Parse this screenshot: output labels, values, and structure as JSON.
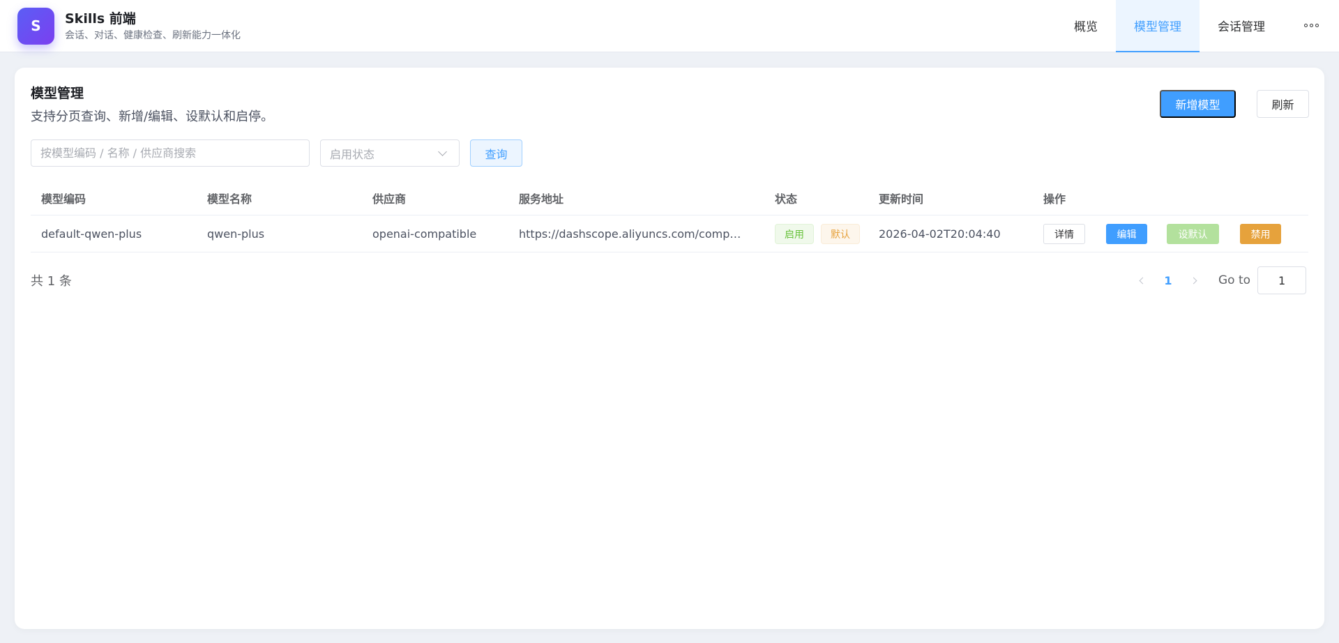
{
  "app": {
    "logo_letter": "S",
    "title": "Skills 前端",
    "subtitle": "会话、对话、健康检查、刷新能力一体化"
  },
  "nav": {
    "items": [
      {
        "label": "概览"
      },
      {
        "label": "模型管理",
        "active": true
      },
      {
        "label": "会话管理"
      }
    ],
    "more_icon": "more-dots-icon"
  },
  "page": {
    "title": "模型管理",
    "description": "支持分页查询、新增/编辑、设默认和启停。",
    "add_label": "新增模型",
    "refresh_label": "刷新"
  },
  "filters": {
    "search_placeholder": "按模型编码 / 名称 / 供应商搜索",
    "search_value": "",
    "status_placeholder": "启用状态",
    "query_label": "查询"
  },
  "table": {
    "headers": {
      "code": "模型编码",
      "name": "模型名称",
      "vendor": "供应商",
      "url": "服务地址",
      "status": "状态",
      "updated": "更新时间",
      "ops": "操作"
    },
    "rows": [
      {
        "code": "default-qwen-plus",
        "name": "qwen-plus",
        "vendor": "openai-compatible",
        "url": "https://dashscope.aliyuncs.com/comp…",
        "status_enabled": "启用",
        "status_default": "默认",
        "updated": "2026-04-02T20:04:40",
        "ops": {
          "detail": "详情",
          "edit": "编辑",
          "set_default": "设默认",
          "disable": "禁用"
        }
      }
    ]
  },
  "pagination": {
    "total_text": "共 1 条",
    "current_page": "1",
    "goto_label": "Go to",
    "goto_value": "1"
  },
  "colors": {
    "primary": "#409eff",
    "success": "#67c23a",
    "warning": "#e6a23c",
    "brand_gradient_start": "#5b5ef5",
    "brand_gradient_end": "#7b3ff0"
  }
}
